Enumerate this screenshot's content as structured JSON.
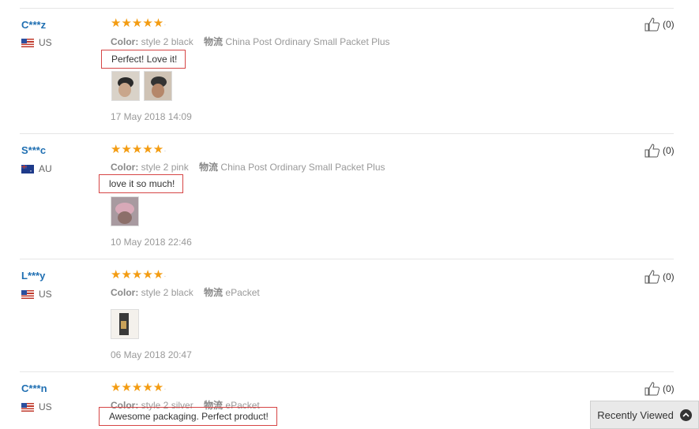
{
  "color_label": "Color:",
  "ship_label": "物流",
  "reviews": [
    {
      "user": "C***z",
      "country": "US",
      "stars": "★★★★★",
      "color_value": "style 2 black",
      "shipping": "China Post Ordinary Small Packet Plus",
      "feedback": "Perfect! Love it!",
      "date": "17 May 2018 14:09",
      "likes": "(0)"
    },
    {
      "user": "S***c",
      "country": "AU",
      "stars": "★★★★★",
      "color_value": "style 2 pink",
      "shipping": "China Post Ordinary Small Packet Plus",
      "feedback": "love it so much!",
      "date": "10 May 2018 22:46",
      "likes": "(0)"
    },
    {
      "user": "L***y",
      "country": "US",
      "stars": "★★★★★",
      "color_value": "style 2 black",
      "shipping": "ePacket",
      "feedback": "",
      "date": "06 May 2018 20:47",
      "likes": "(0)"
    },
    {
      "user": "C***n",
      "country": "US",
      "stars": "★★★★★",
      "color_value": "style 2 silver",
      "shipping": "ePacket",
      "feedback": "Awesome packaging. Perfect product!",
      "date": "",
      "likes": "(0)"
    }
  ],
  "recently_viewed": {
    "label": "Recently Viewed",
    "icon": "chevron-up-icon"
  },
  "colors": {
    "user_link": "#1f6fb2",
    "star": "#f39c12",
    "highlight_box": "#d64545"
  }
}
